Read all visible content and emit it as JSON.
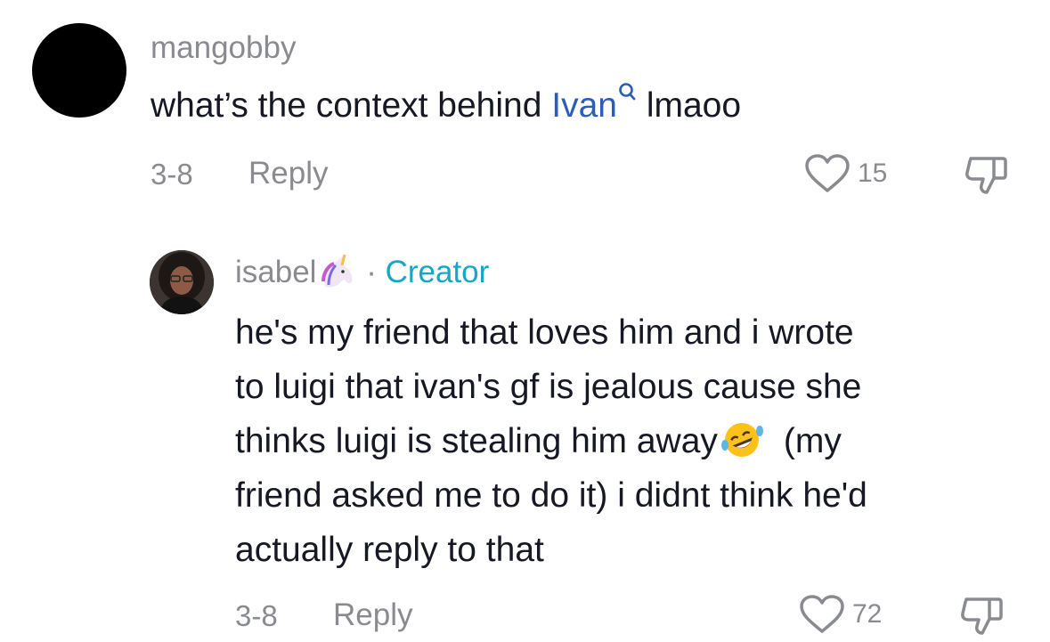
{
  "comment1": {
    "username": "mangobby",
    "text_before_link": "what’s the context behind ",
    "link_text": "Ivan",
    "text_after_link": " lmaoo",
    "date": "3-8",
    "reply_label": "Reply",
    "like_count": "15"
  },
  "comment2": {
    "username": "isabel",
    "username_emoji": "unicorn-emoji",
    "separator": "·",
    "badge": "Creator",
    "lines": [
      "he's my friend that loves him and i wrote",
      "to luigi that ivan's gf is jealous cause she",
      "thinks luigi is stealing him away",
      "(my",
      "friend asked me to do it) i didnt think he'd",
      "actually reply to that"
    ],
    "inline_emoji": "rofl-emoji",
    "date": "3-8",
    "reply_label": "Reply",
    "like_count": "72"
  },
  "colors": {
    "link": "#2b5db9",
    "creator": "#18a5c6",
    "muted": "#8a8b91",
    "text": "#161823"
  }
}
